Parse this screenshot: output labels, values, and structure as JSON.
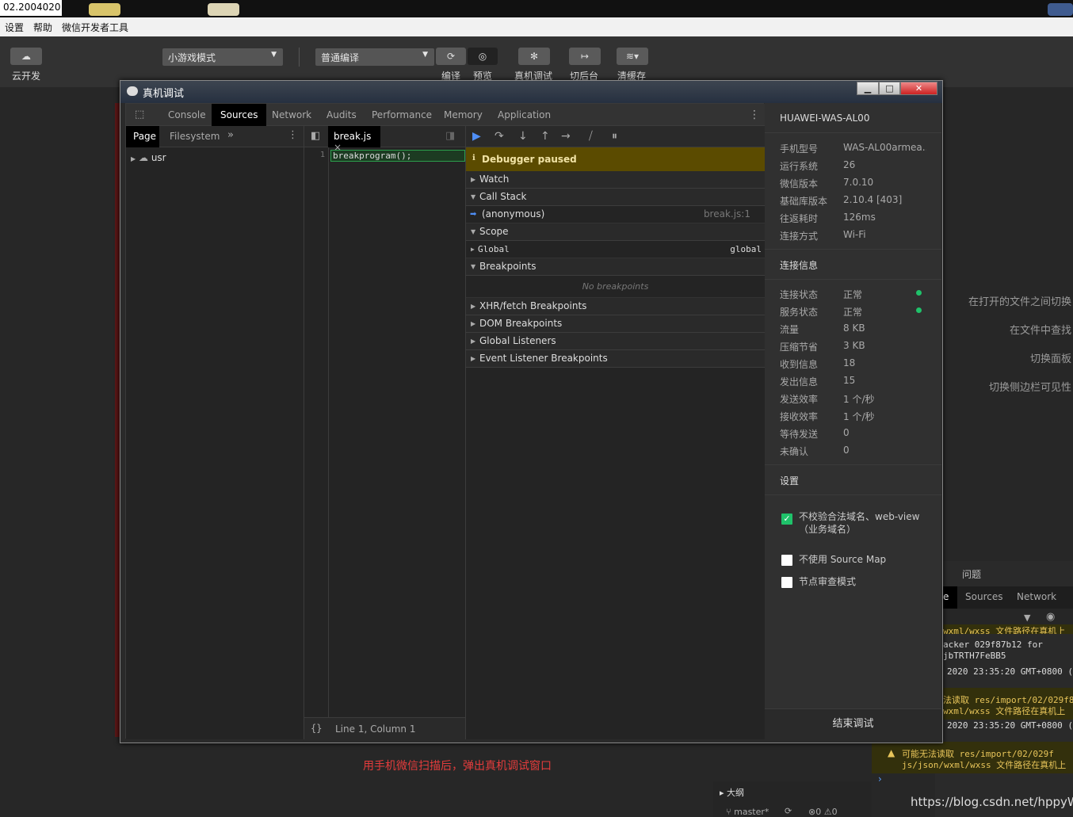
{
  "titlebar": {
    "text": "02.2004020"
  },
  "menubar": {
    "items": [
      "设置",
      "帮助",
      "微信开发者工具"
    ]
  },
  "toolbar": {
    "cloud_label": "云开发",
    "mode_select": "小游戏模式",
    "compile_select": "普通编译",
    "compile_label": "编译",
    "preview_label": "预览",
    "realdebug_label": "真机调试",
    "background_label": "切后台",
    "clearcache_label": "清缓存"
  },
  "hints": [
    "在打开的文件之间切换",
    "在文件中查找",
    "切换面板",
    "切换侧边栏可见性"
  ],
  "dialog": {
    "title": "真机调试",
    "tabs": [
      "Console",
      "Sources",
      "Network",
      "Audits",
      "Performance",
      "Memory",
      "Application"
    ],
    "active_tab": "Sources",
    "navigator": {
      "tabs": [
        "Page",
        "Filesystem"
      ],
      "tree": [
        {
          "label": "usr"
        }
      ]
    },
    "editor": {
      "file_tab": "break.js",
      "line_number": "1",
      "code": "breakprogram();",
      "status": "Line 1, Column 1",
      "format_icon": "{}"
    },
    "debugger": {
      "paused_text": "Debugger paused",
      "watch": "Watch",
      "call_stack": "Call Stack",
      "frame_name": "(anonymous)",
      "frame_loc": "break.js:1",
      "scope": "Scope",
      "scope_name": "Global",
      "scope_value": "global",
      "breakpoints": "Breakpoints",
      "no_breakpoints": "No breakpoints",
      "xhr": "XHR/fetch Breakpoints",
      "dom": "DOM Breakpoints",
      "global_listeners": "Global Listeners",
      "event_listeners": "Event Listener Breakpoints"
    },
    "info": {
      "device": "HUAWEI-WAS-AL00",
      "device_rows": [
        {
          "k": "手机型号",
          "v": "WAS-AL00armea..."
        },
        {
          "k": "运行系统",
          "v": "26"
        },
        {
          "k": "微信版本",
          "v": "7.0.10"
        },
        {
          "k": "基础库版本",
          "v": "2.10.4 [403]"
        },
        {
          "k": "往返耗时",
          "v": "126ms"
        },
        {
          "k": "连接方式",
          "v": "Wi-Fi"
        }
      ],
      "conn_title": "连接信息",
      "conn_rows": [
        {
          "k": "连接状态",
          "v": "正常"
        },
        {
          "k": "服务状态",
          "v": "正常"
        },
        {
          "k": "流量",
          "v": "8 KB"
        },
        {
          "k": "压缩节省",
          "v": "3 KB"
        },
        {
          "k": "收到信息",
          "v": "18"
        },
        {
          "k": "发出信息",
          "v": "15"
        },
        {
          "k": "发送效率",
          "v": "1 个/秒"
        },
        {
          "k": "接收效率",
          "v": "1 个/秒"
        },
        {
          "k": "等待发送",
          "v": "0"
        },
        {
          "k": "未确认",
          "v": "0"
        }
      ],
      "settings_title": "设置",
      "settings": [
        {
          "label": "不校验合法域名、web-view（业务域名）",
          "checked": true
        },
        {
          "label": "不使用 Source Map",
          "checked": false
        },
        {
          "label": "节点审查模式",
          "checked": false
        }
      ],
      "end_button": "结束调试"
    }
  },
  "console_panel": {
    "tab_partial": "问题",
    "tabs": [
      "e",
      "Sources",
      "Network"
    ],
    "lines": [
      "wxml/wxss 文件路径在真机上",
      "acker 029f87b12 for",
      "jbTRTH7FeBB5",
      "2020 23:35:20 GMT+0800 (",
      "法读取 res/import/02/029f8",
      "wxml/wxss 文件路径在真机上",
      "2020 23:35:20 GMT+0800 (",
      "可能无法读取 res/import/02/029f",
      "js/json/wxml/wxss 文件路径在真机上"
    ]
  },
  "caption": "用手机微信扫描后，弹出真机调试窗口",
  "outline": {
    "title": "大纲",
    "branch": "master*",
    "problems": "0",
    "warnings": "0"
  },
  "watermark": "https://blog.csdn.net/hppyW"
}
